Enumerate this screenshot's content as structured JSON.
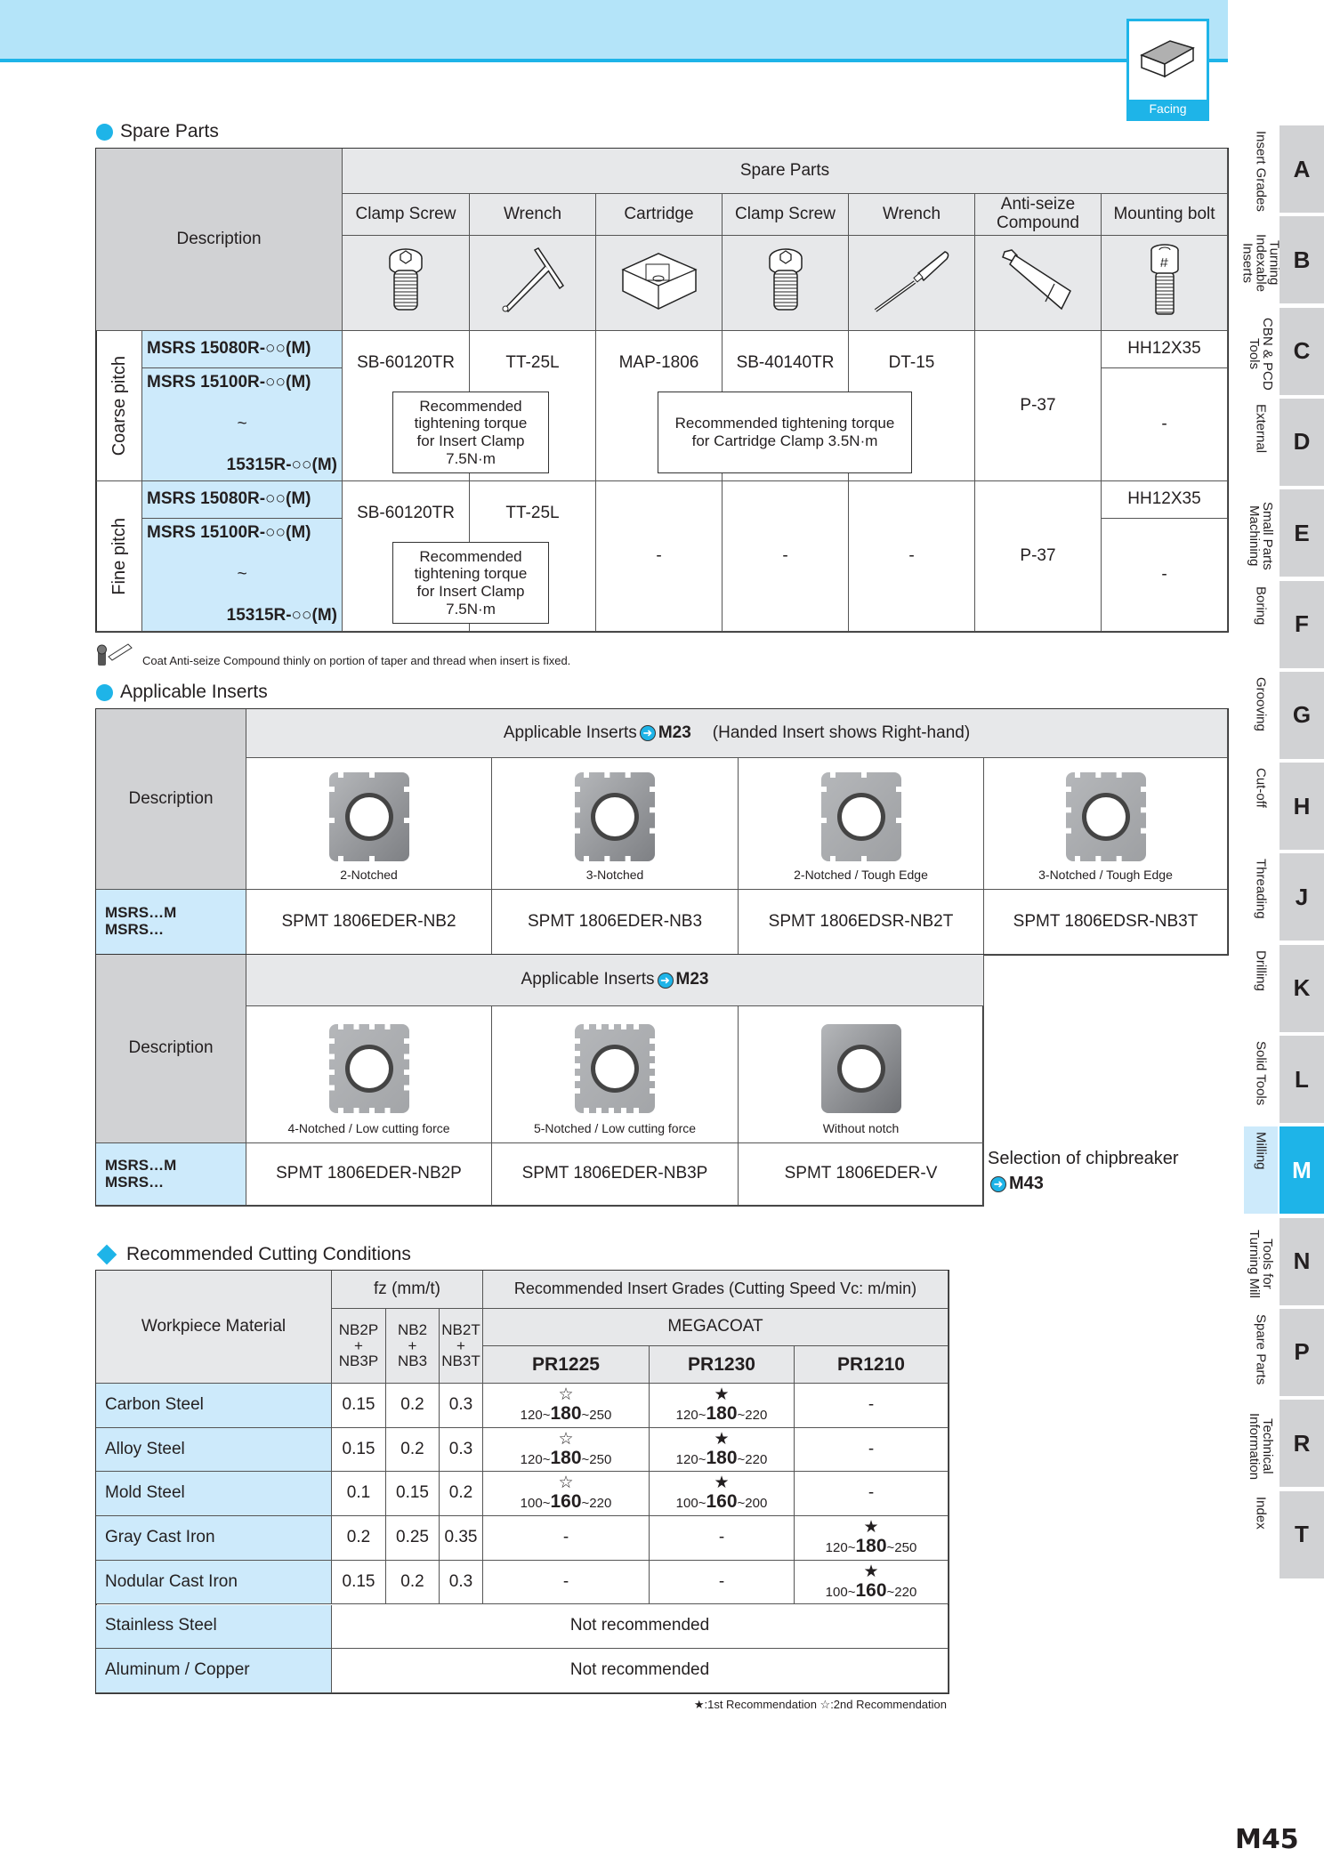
{
  "header": {
    "category_label": "Facing",
    "page_number": "M45",
    "accent_color": "#1eb4e8"
  },
  "spare_parts": {
    "title": "Spare Parts",
    "group_header": "Spare Parts",
    "description_label": "Description",
    "columns": [
      "Clamp Screw",
      "Wrench",
      "Cartridge",
      "Clamp Screw",
      "Wrench",
      "Anti-seize Compound",
      "Mounting bolt"
    ],
    "column_icons": [
      "clamp-screw-icon",
      "t-wrench-icon",
      "cartridge-icon",
      "clamp-screw-icon",
      "screwdriver-icon",
      "compound-tube-icon",
      "mounting-bolt-icon"
    ],
    "groups": [
      {
        "pitch": "Coarse pitch",
        "models": [
          "MSRS  15080R-○○(M)",
          "MSRS  15100R-○○(M)",
          "~",
          "15315R-○○(M)"
        ],
        "clamp_screw": "SB-60120TR",
        "wrench": "TT-25L",
        "cartridge": "MAP-1806",
        "cartridge_clamp_screw": "SB-40140TR",
        "cartridge_wrench": "DT-15",
        "compound": "P-37",
        "mounting_bolt_1": "HH12X35",
        "mounting_bolt_2": "-",
        "torque_insert": [
          "Recommended",
          "tightening torque",
          "for Insert Clamp",
          "7.5N·m"
        ],
        "torque_cartridge": [
          "Recommended tightening torque",
          "for Cartridge Clamp 3.5N·m"
        ]
      },
      {
        "pitch": "Fine pitch",
        "models": [
          "MSRS  15080R-○○(M)",
          "MSRS  15100R-○○(M)",
          "~",
          "15315R-○○(M)"
        ],
        "clamp_screw": "SB-60120TR",
        "wrench": "TT-25L",
        "cartridge": "-",
        "cartridge_clamp_screw": "-",
        "cartridge_wrench": "-",
        "compound": "P-37",
        "mounting_bolt_1": "HH12X35",
        "mounting_bolt_2": "-",
        "torque_insert": [
          "Recommended",
          "tightening torque",
          "for Insert Clamp",
          "7.5N·m"
        ]
      }
    ],
    "note": "Coat Anti-seize Compound thinly on portion of taper and thread when insert is fixed."
  },
  "applicable_inserts": {
    "title": "Applicable Inserts",
    "description_label": "Description",
    "table1": {
      "header_prefix": "Applicable Inserts",
      "header_ref": "M23",
      "header_suffix": "(Handed Insert shows Right-hand)",
      "holders": [
        "MSRS…M",
        "MSRS…"
      ],
      "items": [
        {
          "caption": "2-Notched",
          "code": "SPMT  1806EDER-NB2"
        },
        {
          "caption": "3-Notched",
          "code": "SPMT  1806EDER-NB3"
        },
        {
          "caption": "2-Notched / Tough Edge",
          "code": "SPMT  1806EDSR-NB2T"
        },
        {
          "caption": "3-Notched / Tough Edge",
          "code": "SPMT  1806EDSR-NB3T"
        }
      ]
    },
    "table2": {
      "header_prefix": "Applicable Inserts",
      "header_ref": "M23",
      "holders": [
        "MSRS…M",
        "MSRS…"
      ],
      "items": [
        {
          "caption": "4-Notched / Low cutting force",
          "code": "SPMT  1806EDER-NB2P"
        },
        {
          "caption": "5-Notched / Low cutting force",
          "code": "SPMT  1806EDER-NB3P"
        },
        {
          "caption": "Without notch",
          "code": "SPMT  1806EDER-V"
        }
      ],
      "side_note": "Selection of chipbreaker",
      "side_ref": "M43"
    }
  },
  "cutting_conditions": {
    "title": "Recommended Cutting Conditions",
    "material_label": "Workpiece Material",
    "fz_label": "fz (mm/t)",
    "fz_columns": [
      [
        "NB2P",
        "+",
        "NB3P"
      ],
      [
        "NB2",
        "+",
        "NB3"
      ],
      [
        "NB2T",
        "+",
        "NB3T"
      ]
    ],
    "grades_label": "Recommended Insert Grades (Cutting Speed Vc: m/min)",
    "coating_label": "MEGACOAT",
    "grades": [
      "PR1225",
      "PR1230",
      "PR1210"
    ],
    "rows": [
      {
        "material": "Carbon Steel",
        "fz": [
          "0.15",
          "0.2",
          "0.3"
        ],
        "grades": [
          {
            "star": "☆",
            "min": "120",
            "rec": "180",
            "max": "250"
          },
          {
            "star": "★",
            "min": "120",
            "rec": "180",
            "max": "220"
          },
          {
            "text": "-"
          }
        ]
      },
      {
        "material": "Alloy Steel",
        "fz": [
          "0.15",
          "0.2",
          "0.3"
        ],
        "grades": [
          {
            "star": "☆",
            "min": "120",
            "rec": "180",
            "max": "250"
          },
          {
            "star": "★",
            "min": "120",
            "rec": "180",
            "max": "220"
          },
          {
            "text": "-"
          }
        ]
      },
      {
        "material": "Mold Steel",
        "fz": [
          "0.1",
          "0.15",
          "0.2"
        ],
        "grades": [
          {
            "star": "☆",
            "min": "100",
            "rec": "160",
            "max": "220"
          },
          {
            "star": "★",
            "min": "100",
            "rec": "160",
            "max": "200"
          },
          {
            "text": "-"
          }
        ]
      },
      {
        "material": "Gray Cast Iron",
        "fz": [
          "0.2",
          "0.25",
          "0.35"
        ],
        "grades": [
          {
            "text": "-"
          },
          {
            "text": "-"
          },
          {
            "star": "★",
            "min": "120",
            "rec": "180",
            "max": "250"
          }
        ]
      },
      {
        "material": "Nodular Cast Iron",
        "fz": [
          "0.15",
          "0.2",
          "0.3"
        ],
        "grades": [
          {
            "text": "-"
          },
          {
            "text": "-"
          },
          {
            "star": "★",
            "min": "100",
            "rec": "160",
            "max": "220"
          }
        ]
      },
      {
        "material": "Stainless Steel",
        "span_text": "Not recommended"
      },
      {
        "material": "Aluminum / Copper",
        "span_text": "Not recommended"
      }
    ],
    "legend": "★:1st Recommendation    ☆:2nd Recommendation"
  },
  "side_tabs": [
    {
      "letter": "A",
      "label": "Insert Grades"
    },
    {
      "letter": "B",
      "label": "Turning Indexable Inserts"
    },
    {
      "letter": "C",
      "label": "CBN & PCD Tools"
    },
    {
      "letter": "D",
      "label": "External"
    },
    {
      "letter": "E",
      "label": "Small Parts Machining"
    },
    {
      "letter": "F",
      "label": "Boring"
    },
    {
      "letter": "G",
      "label": "Grooving"
    },
    {
      "letter": "H",
      "label": "Cut-off"
    },
    {
      "letter": "J",
      "label": "Threading"
    },
    {
      "letter": "K",
      "label": "Drilling"
    },
    {
      "letter": "L",
      "label": "Solid Tools"
    },
    {
      "letter": "M",
      "label": "Milling",
      "active": true
    },
    {
      "letter": "N",
      "label": "Tools for Turning Mill"
    },
    {
      "letter": "P",
      "label": "Spare Parts"
    },
    {
      "letter": "R",
      "label": "Technical Information"
    },
    {
      "letter": "T",
      "label": "Index"
    }
  ]
}
